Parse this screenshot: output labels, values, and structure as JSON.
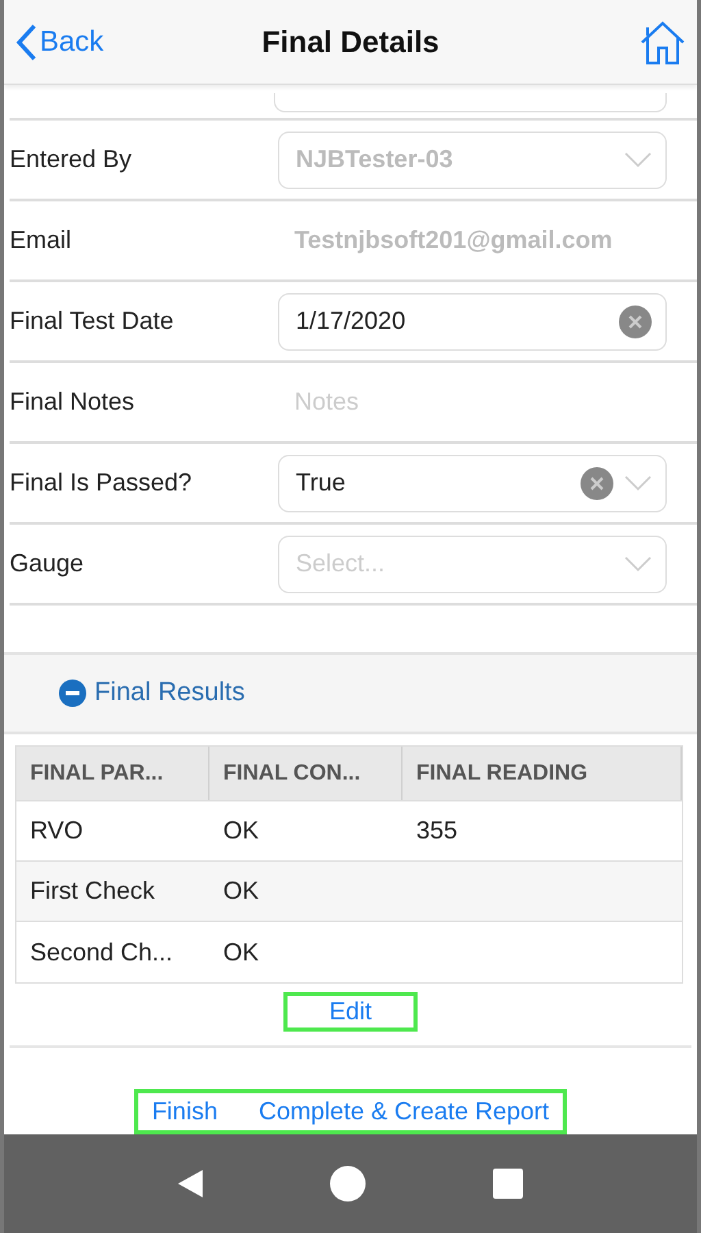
{
  "header": {
    "back": "Back",
    "title": "Final Details"
  },
  "fields": [
    {
      "kind": "select",
      "label": "Entered By",
      "value": "NJBTester-03",
      "disabled": true,
      "clearable": false
    },
    {
      "kind": "static",
      "label": "Email",
      "value": "Testnjbsoft201@gmail.com"
    },
    {
      "kind": "date",
      "label": "Final Test Date",
      "value": "1/17/2020",
      "clearable": true
    },
    {
      "kind": "text",
      "label": "Final Notes",
      "placeholder": "Notes"
    },
    {
      "kind": "select",
      "label": "Final Is Passed?",
      "value": "True",
      "disabled": false,
      "clearable": true
    },
    {
      "kind": "select",
      "label": "Gauge",
      "placeholder": "Select...",
      "disabled": false,
      "clearable": false
    }
  ],
  "results": {
    "title": "Final Results",
    "expanded": true,
    "columns": [
      "FINAL PAR...",
      "FINAL CON...",
      "FINAL READING"
    ],
    "rows": [
      [
        "RVO",
        "OK",
        "355"
      ],
      [
        "First Check",
        "OK",
        ""
      ],
      [
        "Second Ch...",
        "OK",
        ""
      ]
    ],
    "edit": {
      "label": "Edit",
      "highlighted": true
    }
  },
  "actions": {
    "highlighted": true,
    "buttons": [
      "Finish",
      "Complete & Create Report"
    ]
  }
}
